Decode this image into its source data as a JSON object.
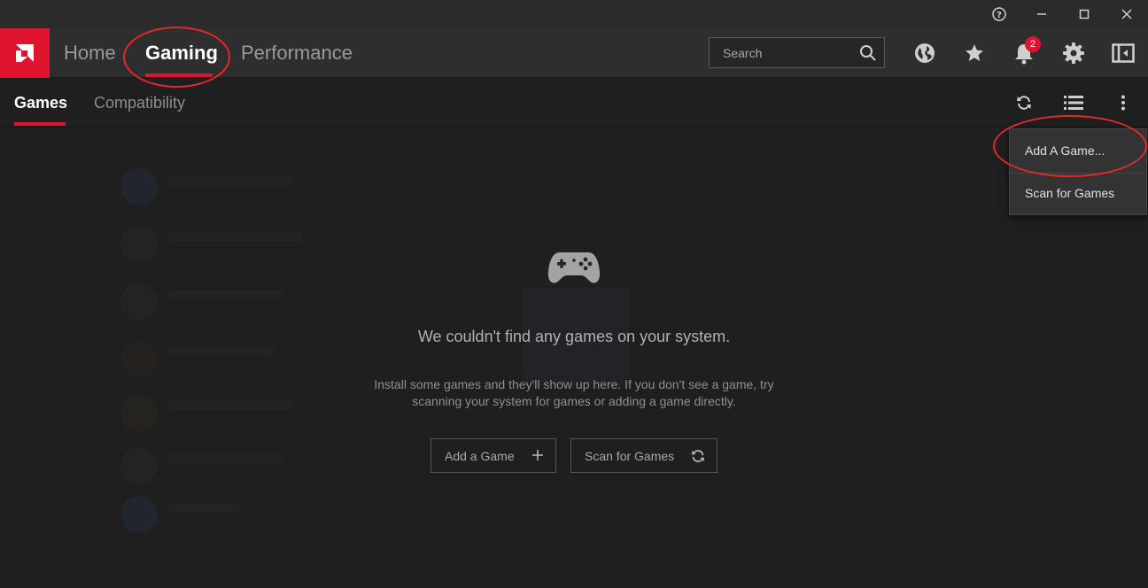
{
  "window": {
    "controls": [
      "help-icon",
      "minimize-icon",
      "maximize-icon",
      "close-icon"
    ]
  },
  "topnav": {
    "tabs": [
      {
        "label": "Home"
      },
      {
        "label": "Gaming"
      },
      {
        "label": "Performance"
      }
    ],
    "search_placeholder": "Search",
    "notification_count": "2",
    "icons": [
      "globe-icon",
      "star-icon",
      "bell-icon",
      "gear-icon",
      "sidebar-toggle-icon"
    ]
  },
  "subnav": {
    "tabs": [
      {
        "label": "Games"
      },
      {
        "label": "Compatibility"
      }
    ],
    "icons": [
      "refresh-icon",
      "list-view-icon",
      "more-options-icon"
    ]
  },
  "empty_state": {
    "title": "We couldn't find any games on your system.",
    "description_line1": "Install some games and they'll show up here. If you don't see a game, try",
    "description_line2": "scanning your system for games or adding a game directly.",
    "add_button": "Add a Game",
    "scan_button": "Scan for Games"
  },
  "menu": {
    "items": [
      {
        "label": "Add A Game..."
      },
      {
        "label": "Scan for Games"
      }
    ]
  },
  "colors": {
    "accent": "#e0142e",
    "annotation": "#e02a2a",
    "background": "#232323"
  }
}
